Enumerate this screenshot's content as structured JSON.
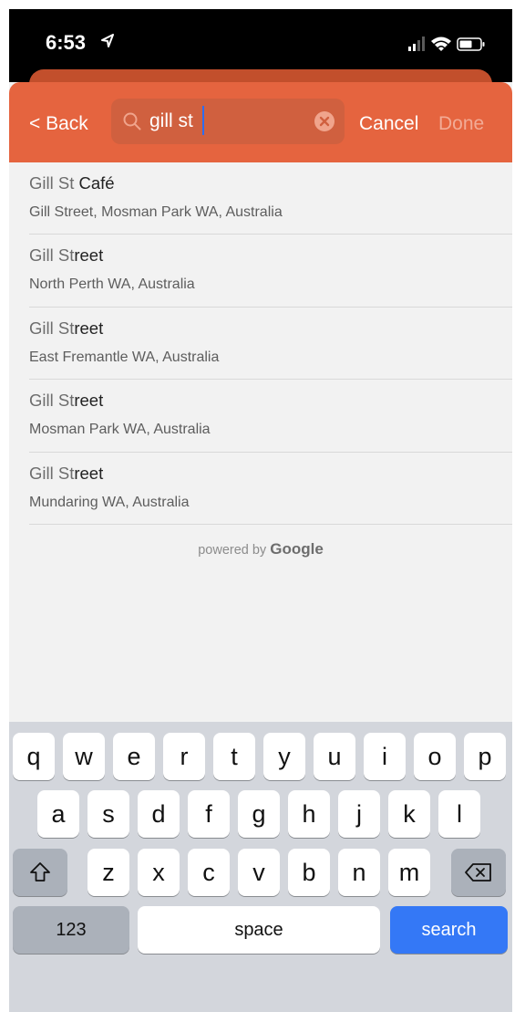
{
  "status_bar": {
    "time": "6:53"
  },
  "header": {
    "back_label": "< Back",
    "search_value": "gill st",
    "cancel_label": "Cancel",
    "done_label": "Done"
  },
  "results": [
    {
      "title_match": "Gill St",
      "title_rest": " Café",
      "subtitle": "Gill Street, Mosman Park WA, Australia"
    },
    {
      "title_match": "Gill St",
      "title_rest": "reet",
      "subtitle": "North Perth WA, Australia"
    },
    {
      "title_match": "Gill St",
      "title_rest": "reet",
      "subtitle": "East Fremantle WA, Australia"
    },
    {
      "title_match": "Gill St",
      "title_rest": "reet",
      "subtitle": "Mosman Park WA, Australia"
    },
    {
      "title_match": "Gill St",
      "title_rest": "reet",
      "subtitle": "Mundaring WA, Australia"
    }
  ],
  "attribution": {
    "prefix": "powered by ",
    "brand": "Google"
  },
  "keyboard": {
    "row1": [
      "q",
      "w",
      "e",
      "r",
      "t",
      "y",
      "u",
      "i",
      "o",
      "p"
    ],
    "row2": [
      "a",
      "s",
      "d",
      "f",
      "g",
      "h",
      "j",
      "k",
      "l"
    ],
    "row3": [
      "z",
      "x",
      "c",
      "v",
      "b",
      "n",
      "m"
    ],
    "numbers_label": "123",
    "space_label": "space",
    "search_label": "search",
    "shift_icon": "shift-arrow-icon",
    "delete_icon": "delete-backspace-icon"
  },
  "colors": {
    "header": "#e5643f",
    "search_field": "#d0603f",
    "done_disabled": "#f2ab96",
    "search_key": "#3478f6",
    "keyboard_bg": "#d3d6dc"
  }
}
